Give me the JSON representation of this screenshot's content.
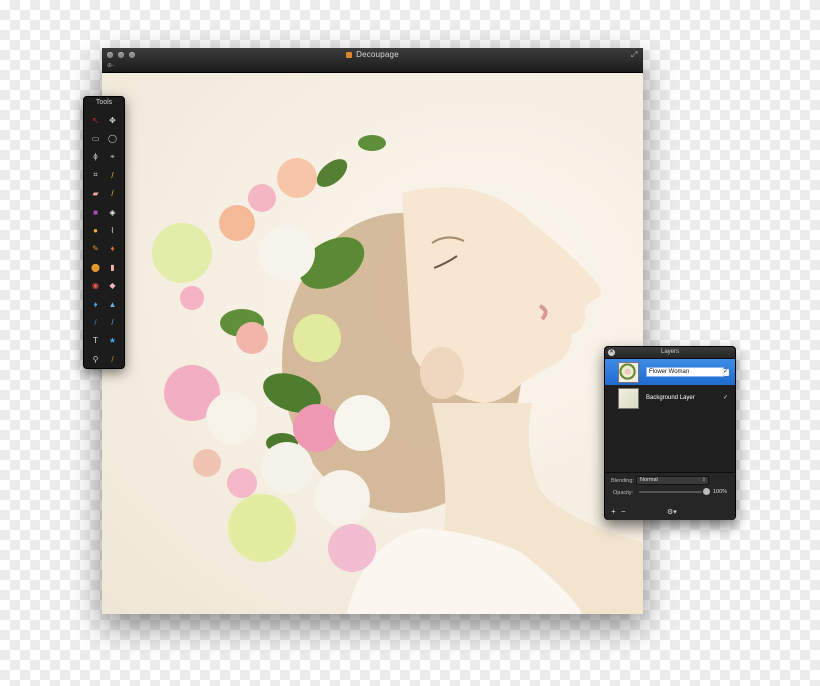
{
  "window": {
    "title": "Decoupage",
    "zoom_control": "⊕-"
  },
  "tools_palette": {
    "title": "Tools",
    "tools": [
      {
        "icon": "pointer-icon",
        "glyph": "↖",
        "color": "#c9303a"
      },
      {
        "icon": "move-icon",
        "glyph": "✥",
        "color": "#dddddd"
      },
      {
        "icon": "rect-select-icon",
        "glyph": "▭",
        "color": "#cccccc"
      },
      {
        "icon": "ellipse-select-icon",
        "glyph": "◯",
        "color": "#cccccc"
      },
      {
        "icon": "lasso-icon",
        "glyph": "ɸ",
        "color": "#cccccc"
      },
      {
        "icon": "polygon-lasso-icon",
        "glyph": "⌖",
        "color": "#cccccc"
      },
      {
        "icon": "crop-icon",
        "glyph": "⌗",
        "color": "#cccccc"
      },
      {
        "icon": "eyedropper-icon",
        "glyph": "/",
        "color": "#f0c23a"
      },
      {
        "icon": "eraser-icon",
        "glyph": "▰",
        "color": "#f1a9a1"
      },
      {
        "icon": "pencil-icon",
        "glyph": "/",
        "color": "#e6c15a"
      },
      {
        "icon": "gradient-icon",
        "glyph": "■",
        "color": "#b04ec0"
      },
      {
        "icon": "paint-bucket-icon",
        "glyph": "◈",
        "color": "#e9e9e9"
      },
      {
        "icon": "shape-icon",
        "glyph": "●",
        "color": "#f3b32b"
      },
      {
        "icon": "brush-icon",
        "glyph": "⌇",
        "color": "#dddddd"
      },
      {
        "icon": "smudge-icon",
        "glyph": "✎",
        "color": "#e08f2e"
      },
      {
        "icon": "burn-icon",
        "glyph": "♦",
        "color": "#e0712b"
      },
      {
        "icon": "stamp-icon",
        "glyph": "⬤",
        "color": "#e39a33"
      },
      {
        "icon": "heal-icon",
        "glyph": "▮",
        "color": "#f2b2a0"
      },
      {
        "icon": "red-eye-icon",
        "glyph": "◉",
        "color": "#e55a4a"
      },
      {
        "icon": "sponge-icon",
        "glyph": "◆",
        "color": "#f3b6c1"
      },
      {
        "icon": "blur-icon",
        "glyph": "♦",
        "color": "#4fa1e4"
      },
      {
        "icon": "sharpen-icon",
        "glyph": "▲",
        "color": "#6fb2ea"
      },
      {
        "icon": "pen-icon",
        "glyph": "/",
        "color": "#3c8ed8"
      },
      {
        "icon": "line-icon",
        "glyph": "/",
        "color": "#5aa8ef"
      },
      {
        "icon": "text-icon",
        "glyph": "T",
        "color": "#dddddd"
      },
      {
        "icon": "star-shape-icon",
        "glyph": "★",
        "color": "#4aa3e8"
      },
      {
        "icon": "zoom-icon",
        "glyph": "⚲",
        "color": "#cccccc"
      },
      {
        "icon": "color-picker-icon",
        "glyph": "/",
        "color": "#e08a2a"
      }
    ]
  },
  "layers_palette": {
    "title": "Layers",
    "layers": [
      {
        "name": "Flower Woman",
        "selected": true,
        "visible": true,
        "editing": true
      },
      {
        "name": "Background Layer",
        "selected": false,
        "visible": true,
        "editing": false
      }
    ],
    "blending_label": "Blending:",
    "blending_value": "Normal",
    "opacity_label": "Opacity:",
    "opacity_value": "100%",
    "add_button": "+",
    "remove_button": "−",
    "settings_button": "⚙▾"
  },
  "colors": {
    "selection_blue": "#2a78dc",
    "traffic_light": "#8a8a8a"
  }
}
